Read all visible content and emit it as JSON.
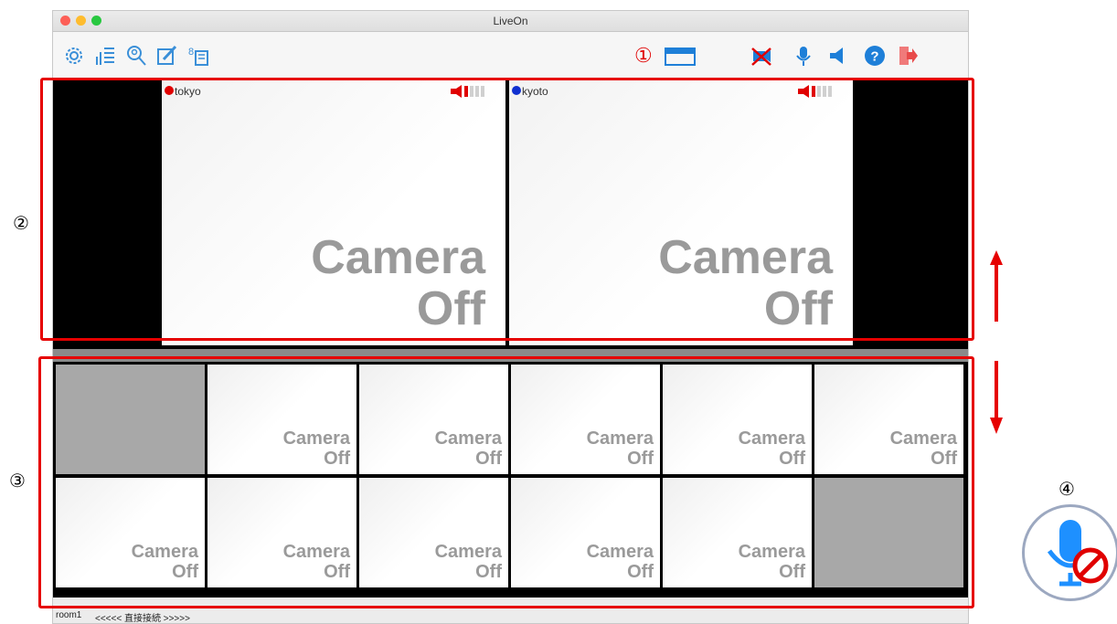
{
  "window": {
    "title": "LiveOn"
  },
  "toolbar": {
    "icons": [
      "gear-icon",
      "level-meter-icon",
      "search-user-icon",
      "whiteboard-icon",
      "document-share-icon",
      "layout-icon",
      "camera-off-icon",
      "mic-icon",
      "speaker-icon",
      "help-icon",
      "exit-icon"
    ],
    "marker": "①"
  },
  "main": {
    "participants": [
      {
        "name": "tokyo",
        "dot_color": "#e00000",
        "camera_text_1": "Camera",
        "camera_text_2": "Off"
      },
      {
        "name": "kyoto",
        "dot_color": "#1030d0",
        "camera_text_1": "Camera",
        "camera_text_2": "Off"
      }
    ]
  },
  "grid": {
    "row1": [
      {
        "camera_text_1": "",
        "camera_text_2": ""
      },
      {
        "camera_text_1": "Camera",
        "camera_text_2": "Off"
      },
      {
        "camera_text_1": "Camera",
        "camera_text_2": "Off"
      },
      {
        "camera_text_1": "Camera",
        "camera_text_2": "Off"
      },
      {
        "camera_text_1": "Camera",
        "camera_text_2": "Off"
      },
      {
        "camera_text_1": "Camera",
        "camera_text_2": "Off"
      }
    ],
    "row2": [
      {
        "camera_text_1": "Camera",
        "camera_text_2": "Off"
      },
      {
        "camera_text_1": "Camera",
        "camera_text_2": "Off"
      },
      {
        "camera_text_1": "Camera",
        "camera_text_2": "Off"
      },
      {
        "camera_text_1": "Camera",
        "camera_text_2": "Off"
      },
      {
        "camera_text_1": "Camera",
        "camera_text_2": "Off"
      },
      {
        "camera_text_1": "",
        "camera_text_2": ""
      }
    ]
  },
  "status": {
    "room": "room1",
    "connection": "<<<<< 直接接続 >>>>>"
  },
  "annotations": {
    "label_2": "②",
    "label_3": "③",
    "label_4": "④"
  },
  "colors": {
    "highlight": "#e60000",
    "mic_blue": "#1e90ff"
  }
}
